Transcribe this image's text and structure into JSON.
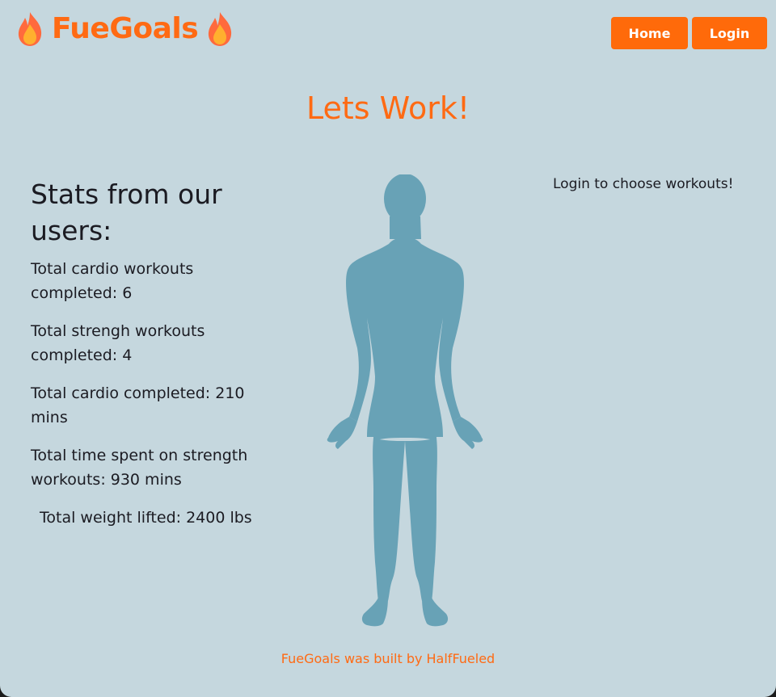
{
  "header": {
    "brand_name": "FueGoals",
    "brand_icon": "fire-icon",
    "nav": {
      "home_label": "Home",
      "login_label": "Login"
    }
  },
  "main": {
    "title": "Lets Work!",
    "stats": {
      "heading": "Stats from our users:",
      "items": [
        "Total cardio workouts completed: 6",
        "Total strengh workouts completed: 4",
        "Total cardio completed: 210 mins",
        "Total time spent on strength workouts: 930 mins",
        "Total weight lifted: 2400 lbs"
      ]
    },
    "body_figure_icon": "human-body-silhouette",
    "login_note": "Login to choose workouts!"
  },
  "footer": {
    "text": "FueGoals was built by HalfFueled"
  },
  "colors": {
    "background": "#c5d7de",
    "accent": "#ff6a13",
    "figure": "#68a2b6",
    "text": "#1b1b22"
  }
}
